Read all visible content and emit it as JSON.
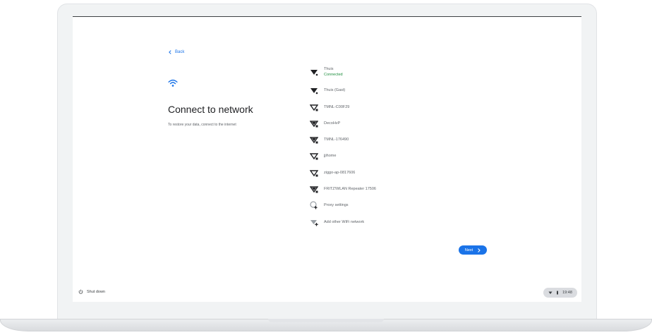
{
  "screen": {
    "back_label": "Back",
    "title": "Connect to network",
    "subtitle": "To restore your data, connect to the internet"
  },
  "networks": [
    {
      "name": "Thuis",
      "status": "Connected",
      "icon": "wifi-icon"
    },
    {
      "name": "Thuis (Gast)",
      "icon": "wifi-icon"
    },
    {
      "name": "TMNL-C00F29",
      "icon": "wifi-locked-icon"
    },
    {
      "name": "DecoHvP",
      "icon": "wifi-locked-icon"
    },
    {
      "name": "TMNL-176490",
      "icon": "wifi-locked-icon"
    },
    {
      "name": "jjihome",
      "icon": "wifi-locked-icon"
    },
    {
      "name": "ziggo-ap-0817606",
      "icon": "wifi-locked-icon"
    },
    {
      "name": "FRITZ!WLAN Repeater 17506",
      "icon": "wifi-locked-icon"
    },
    {
      "name": "Proxy settings",
      "icon": "proxy-settings-icon"
    },
    {
      "name": "Add other WiFi network",
      "icon": "add-wifi-icon"
    }
  ],
  "next_label": "Next",
  "shelf": {
    "shutdown_label": "Shut down",
    "time": "19:48"
  },
  "colors": {
    "accent": "#1a73e8",
    "connected": "#1e8e3e",
    "text_primary": "#202124",
    "text_secondary": "#5f6368"
  }
}
